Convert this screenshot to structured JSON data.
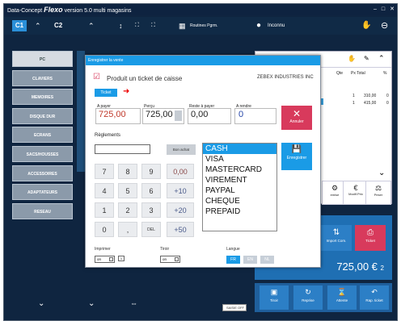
{
  "window": {
    "app": "Data-Concept",
    "brand": "Flexo",
    "version": "version 5.0 multi magasins",
    "controls": [
      "–",
      "□",
      "✕"
    ]
  },
  "toolbar": {
    "c1": "C1",
    "c2": "C2",
    "routines_label": "Routines Pgrm.",
    "user_label": "Inconnu"
  },
  "sidebar": {
    "items": [
      "PC",
      "CLAVIERS",
      "MEMOIRES",
      "DISQUE DUR",
      "ECRANS",
      "SACS/HOUSSES",
      "ACCESSOIRES",
      "ADAPTATEURS",
      "RESEAU"
    ]
  },
  "ticket_table": {
    "headers": [
      "Qte",
      "Px Total",
      "%"
    ],
    "rows": [
      {
        "qte": "1",
        "total": "310,00",
        "pct": "0"
      },
      {
        "qte": "1",
        "total": "415,00",
        "pct": "0"
      }
    ]
  },
  "right_funcs": [
    {
      "label": "emise"
    },
    {
      "label": "Modif.Prix"
    },
    {
      "label": "Peser"
    }
  ],
  "right_actions": {
    "import_label": "Import Com.",
    "ticket_label": "Ticket",
    "total": "725,00 €",
    "count": "2"
  },
  "bottom_buttons": [
    {
      "label": "Tiroir"
    },
    {
      "label": "Reprise"
    },
    {
      "label": "Attente"
    },
    {
      "label": "Rap. ticket"
    }
  ],
  "status": {
    "offline_badge": "SAISIE OFF"
  },
  "modal": {
    "title": "Enregistrer la vente",
    "produce_ticket": "Produit un ticket de caisse",
    "company": "ZEBEX INDUSTRIES INC",
    "ticket_btn": "Ticket",
    "fields": {
      "a_payer_label": "A payer",
      "a_payer": "725,00",
      "percu_label": "Perçu",
      "percu": "725,00",
      "reste_label": "Reste à payer",
      "reste": "0,00",
      "rendre_label": "A rendre",
      "rendre": "0"
    },
    "annuler": "Annuler",
    "reglements_label": "Règlements",
    "bon_achat": "Bon achat",
    "keypad": {
      "digits": [
        "7",
        "8",
        "9",
        "4",
        "5",
        "6",
        "1",
        "2",
        "3",
        "0",
        ",",
        "DEL"
      ],
      "ops": [
        "0,00",
        "+10",
        "+20",
        "+50"
      ]
    },
    "payment_methods": [
      "CASH",
      "VISA",
      "MASTERCARD",
      "VIREMENT",
      "PAYPAL",
      "CHEQUE",
      "PREPAID"
    ],
    "selected_payment": "CASH",
    "enregistrer": "Enregistrer",
    "imprimer_label": "Imprimer",
    "imprimer_state": "on",
    "imprimer_copies": "1",
    "tiroir_label": "Tiroir",
    "tiroir_state": "on",
    "langue_label": "Langue",
    "languages": [
      "FR",
      "EN",
      "NL"
    ],
    "selected_language": "FR"
  },
  "colors": {
    "accent": "#1a9be6",
    "danger": "#d83a5c",
    "background": "#0f2540"
  }
}
